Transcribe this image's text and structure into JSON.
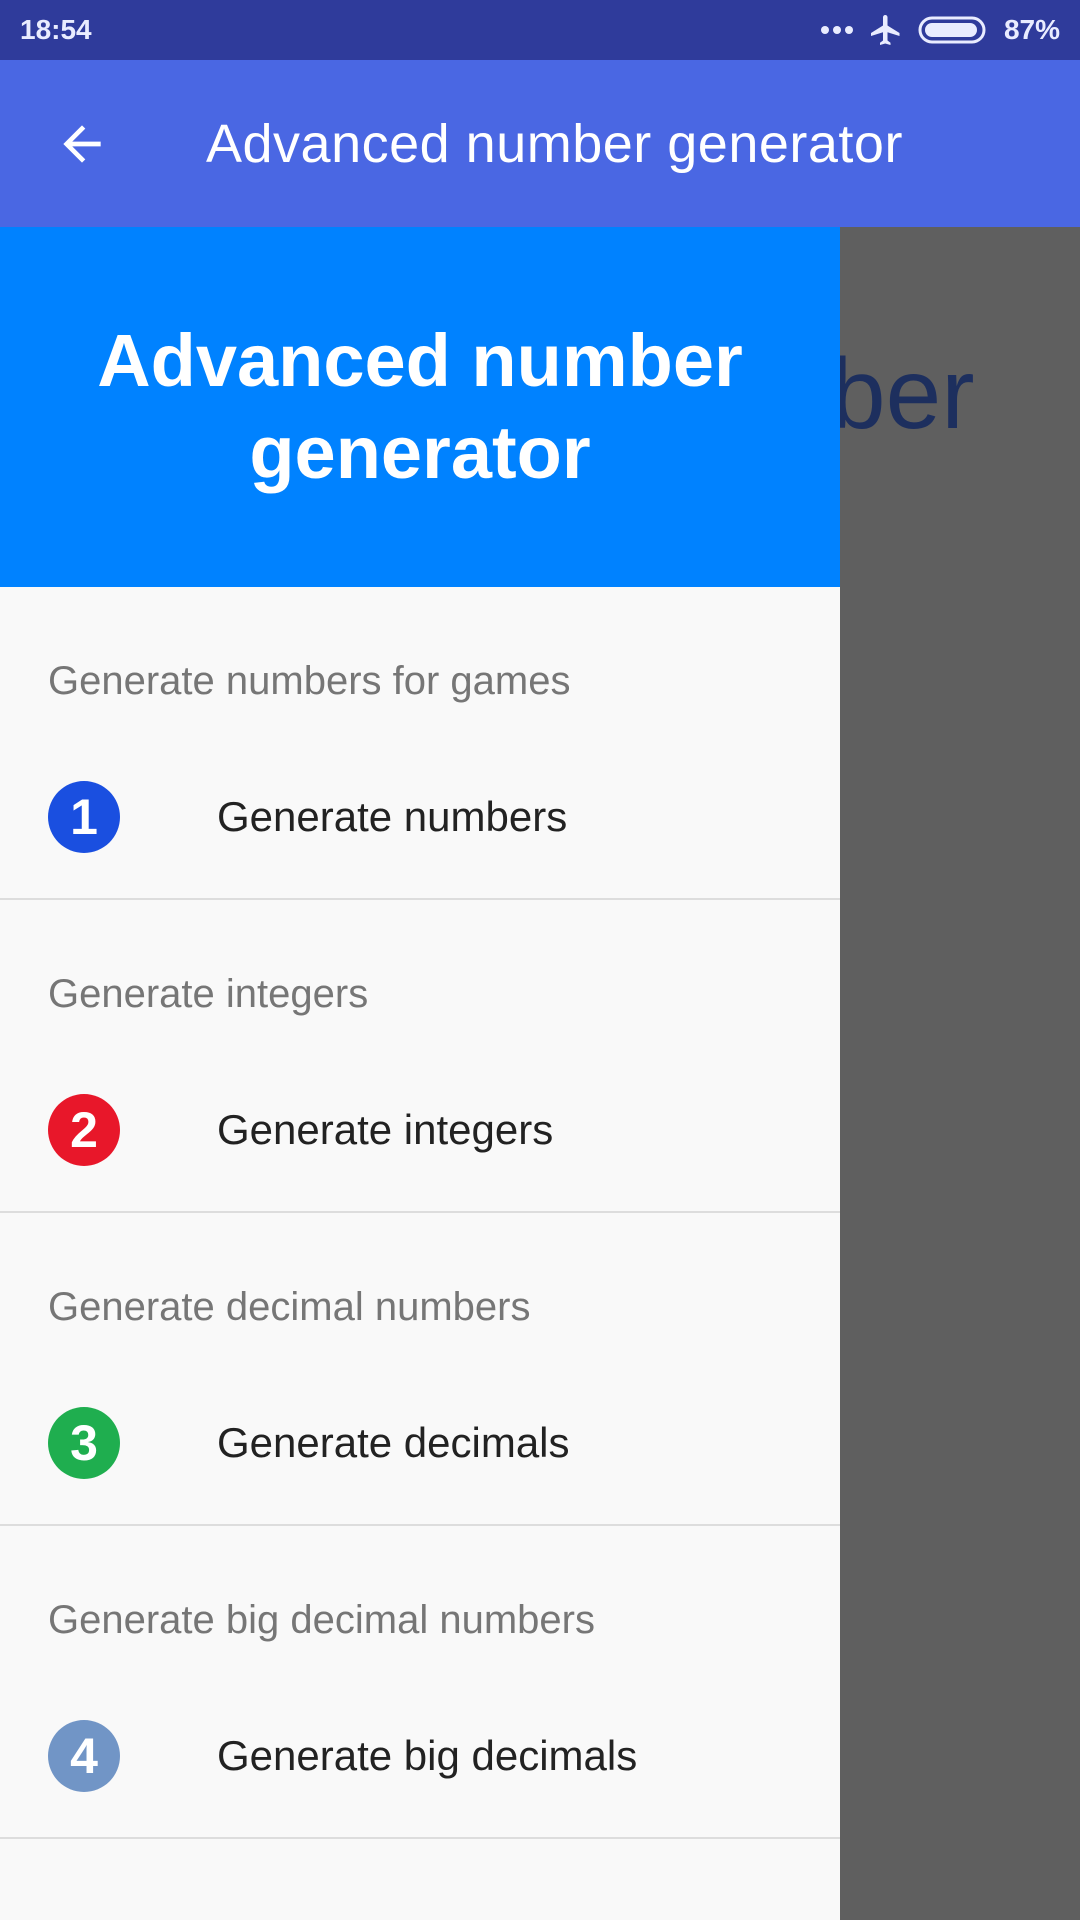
{
  "status_bar": {
    "time": "18:54",
    "battery_percent": "87%",
    "icons": [
      "more-dots-icon",
      "airplane-mode-icon",
      "battery-icon"
    ]
  },
  "app_bar": {
    "title": "Advanced number generator",
    "back_icon": "arrow-left-icon"
  },
  "background": {
    "partial_text": "ber"
  },
  "drawer": {
    "header_title": "Advanced number generator",
    "sections": [
      {
        "header": "Generate numbers for games",
        "item": {
          "number": "1",
          "label": "Generate numbers",
          "badge_color": "#1a4fe0"
        }
      },
      {
        "header": "Generate integers",
        "item": {
          "number": "2",
          "label": "Generate integers",
          "badge_color": "#e8172a"
        }
      },
      {
        "header": "Generate decimal numbers",
        "item": {
          "number": "3",
          "label": "Generate decimals",
          "badge_color": "#1fae4f"
        }
      },
      {
        "header": "Generate big decimal numbers",
        "item": {
          "number": "4",
          "label": "Generate big decimals",
          "badge_color": "#7195c6"
        }
      }
    ]
  },
  "colors": {
    "status_bar": "#2f3b9b",
    "app_bar": "#4a67e3",
    "drawer_header": "#0082ff",
    "scrim": "#5f5f5f"
  }
}
